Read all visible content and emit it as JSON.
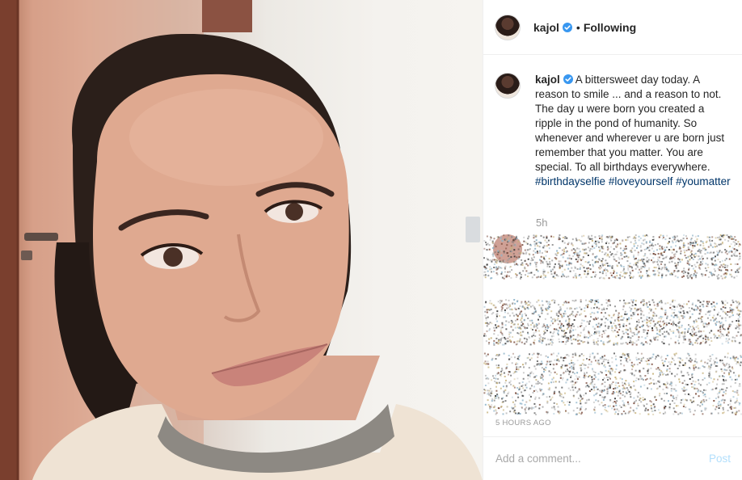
{
  "post": {
    "photo_alt": "selfie photo",
    "author": {
      "username": "kajol",
      "verified": true
    },
    "follow_status": "Following",
    "separator": "•",
    "caption": {
      "username": "kajol",
      "text": "A bittersweet day today. A reason to smile ... and a reason to not. The day u were born you created a ripple in the pond of humanity. So whenever and wherever u are born just remember that you matter. You are special. To all birthdays everywhere.",
      "hashtags": [
        "#birthdayselfie",
        "#loveyourself",
        "#youmatter"
      ],
      "time_ago": "5h"
    },
    "timestamp": "5 HOURS AGO",
    "comment_box": {
      "placeholder": "Add a comment...",
      "post_label": "Post"
    }
  },
  "colors": {
    "verified_badge": "#3897f0",
    "hashtag": "#003569",
    "post_button_disabled": "#b2dffc",
    "muted_text": "#999999"
  },
  "icons": {
    "verified": "verified-badge-icon"
  }
}
